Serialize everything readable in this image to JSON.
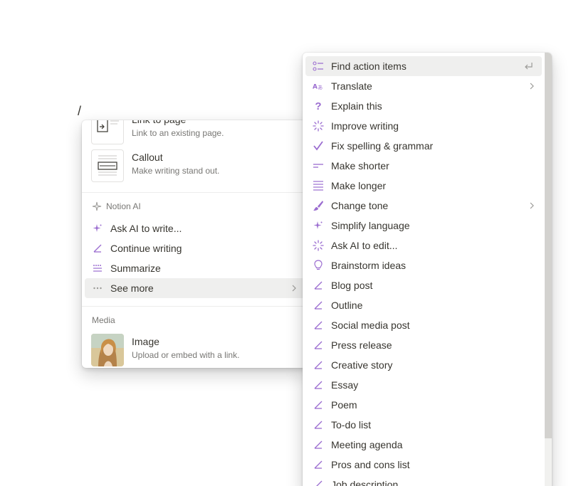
{
  "editor": {
    "slash": "/"
  },
  "left_menu": {
    "blocks": [
      {
        "title": "Link to page",
        "desc": "Link to an existing page."
      },
      {
        "title": "Callout",
        "desc": "Make writing stand out."
      }
    ],
    "notion_ai_label": "Notion AI",
    "ai_items": [
      {
        "label": "Ask AI to write...",
        "icon": "sparkle-icon"
      },
      {
        "label": "Continue writing",
        "icon": "pen-icon"
      },
      {
        "label": "Summarize",
        "icon": "summarize-icon"
      },
      {
        "label": "See more",
        "icon": "more-icon"
      }
    ],
    "media_label": "Media",
    "media_items": [
      {
        "title": "Image",
        "desc": "Upload or embed with a link."
      }
    ]
  },
  "right_menu": {
    "items": [
      {
        "label": "Find action items",
        "icon": "checklist-icon"
      },
      {
        "label": "Translate",
        "icon": "translate-icon"
      },
      {
        "label": "Explain this",
        "icon": "question-icon"
      },
      {
        "label": "Improve writing",
        "icon": "burst-icon"
      },
      {
        "label": "Fix spelling & grammar",
        "icon": "check-icon"
      },
      {
        "label": "Make shorter",
        "icon": "short-lines-icon"
      },
      {
        "label": "Make longer",
        "icon": "long-lines-icon"
      },
      {
        "label": "Change tone",
        "icon": "brush-icon"
      },
      {
        "label": "Simplify language",
        "icon": "sparkle-icon"
      },
      {
        "label": "Ask AI to edit...",
        "icon": "burst-icon"
      },
      {
        "label": "Brainstorm ideas",
        "icon": "lightbulb-icon"
      },
      {
        "label": "Blog post",
        "icon": "pen-icon"
      },
      {
        "label": "Outline",
        "icon": "pen-icon"
      },
      {
        "label": "Social media post",
        "icon": "pen-icon"
      },
      {
        "label": "Press release",
        "icon": "pen-icon"
      },
      {
        "label": "Creative story",
        "icon": "pen-icon"
      },
      {
        "label": "Essay",
        "icon": "pen-icon"
      },
      {
        "label": "Poem",
        "icon": "pen-icon"
      },
      {
        "label": "To-do list",
        "icon": "pen-icon"
      },
      {
        "label": "Meeting agenda",
        "icon": "pen-icon"
      },
      {
        "label": "Pros and cons list",
        "icon": "pen-icon"
      },
      {
        "label": "Job description",
        "icon": "pen-icon"
      }
    ]
  },
  "colors": {
    "ai_purple": "#9b6dd0",
    "hover_bg": "#efefee",
    "text": "#37352f",
    "muted": "#787774"
  }
}
